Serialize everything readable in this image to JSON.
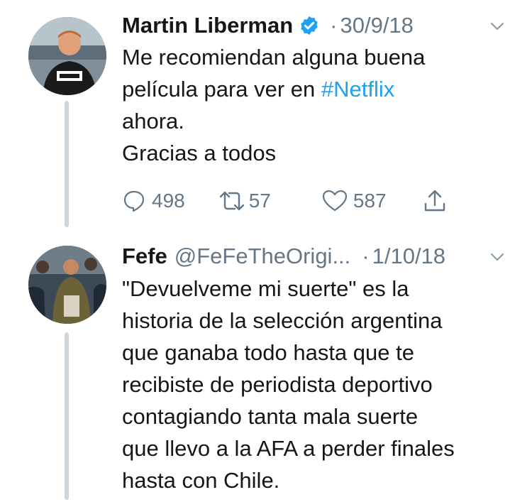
{
  "tweet1": {
    "author_name": "Martin Liberman",
    "verified": true,
    "separator": "·",
    "date": "30/9/18",
    "text_before_hashtag": "Me recomiendan alguna buena\npelícula para ver en ",
    "hashtag": "#Netflix",
    "text_after_hashtag": "\nahora.\nGracias a todos",
    "actions": {
      "reply_count": "498",
      "retweet_count": "57",
      "like_count": "587"
    }
  },
  "tweet2": {
    "author_name": "Fefe",
    "handle": "@FeFeTheOrigi...",
    "separator": "·",
    "date": "1/10/18",
    "text": "\"Devuelveme mi suerte\" es la\nhistoria de la selección argentina\nque ganaba todo hasta que te\nrecibiste de periodista deportivo\ncontagiando tanta mala suerte\nque llevo a la AFA a perder finales\nhasta con Chile."
  },
  "icons": [
    "verified-icon",
    "chevron-down-icon",
    "reply-icon",
    "retweet-icon",
    "like-icon",
    "share-icon"
  ],
  "colors": {
    "link": "#1da1f2",
    "secondary_text": "#657786",
    "thread_line": "#cdd6dd",
    "primary_text": "#14171a"
  }
}
